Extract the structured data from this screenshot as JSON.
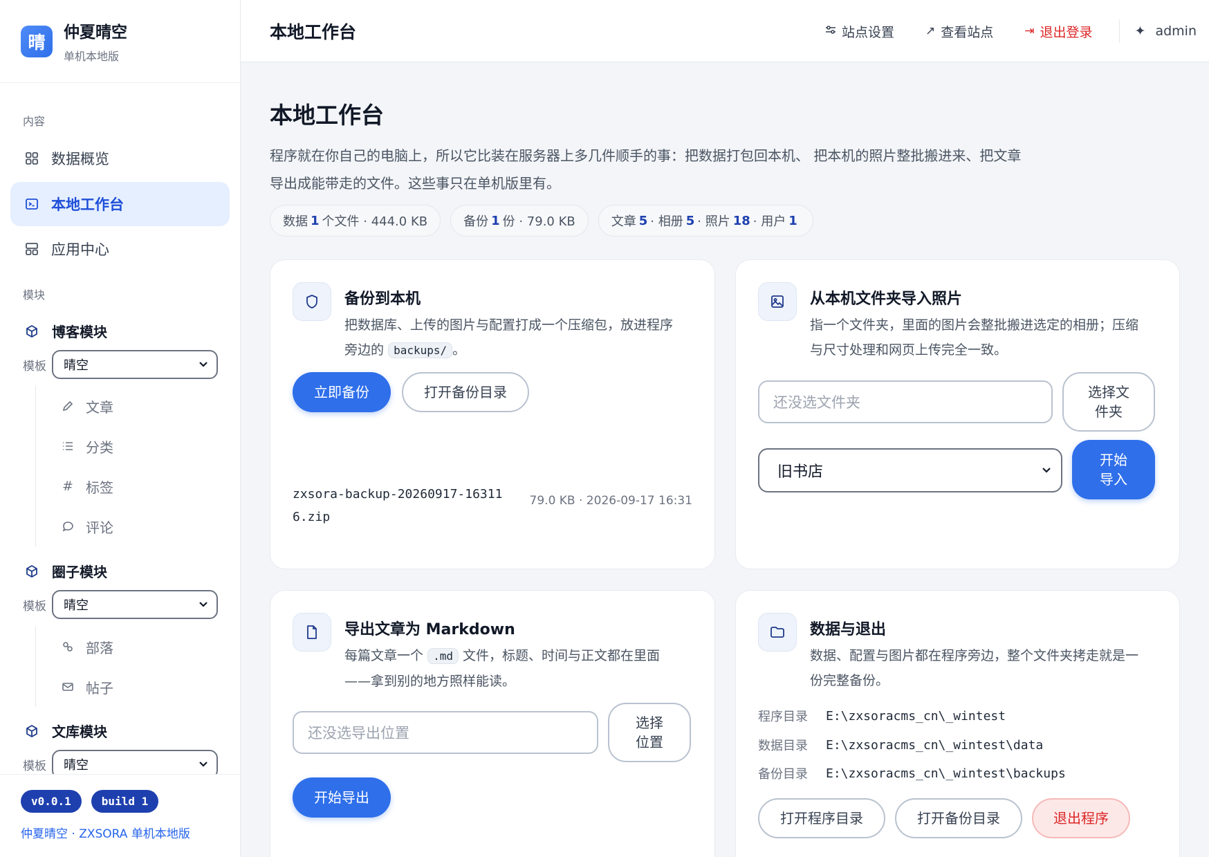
{
  "brand": {
    "logo_char": "晴",
    "title": "仲夏晴空",
    "subtitle": "单机本地版"
  },
  "sidebar": {
    "section_content": "内容",
    "nav": [
      {
        "label": "数据概览",
        "icon": "grid-icon"
      },
      {
        "label": "本地工作台",
        "icon": "terminal-icon",
        "active": true
      },
      {
        "label": "应用中心",
        "icon": "apps-icon"
      }
    ],
    "section_modules": "模块",
    "template_label": "模板",
    "modules": [
      {
        "title": "博客模块",
        "template": "晴空",
        "items": [
          {
            "label": "文章",
            "icon": "pencil-icon"
          },
          {
            "label": "分类",
            "icon": "list-icon"
          },
          {
            "label": "标签",
            "icon": "hash-icon"
          },
          {
            "label": "评论",
            "icon": "comment-icon"
          }
        ]
      },
      {
        "title": "圈子模块",
        "template": "晴空",
        "items": [
          {
            "label": "部落",
            "icon": "link-icon"
          },
          {
            "label": "帖子",
            "icon": "mail-icon"
          }
        ]
      },
      {
        "title": "文库模块",
        "template": "晴空",
        "items": []
      }
    ],
    "footer": {
      "version": "v0.0.1",
      "build": "build 1",
      "text": "仲夏晴空 · ZXSORA 单机本地版"
    }
  },
  "header": {
    "title": "本地工作台",
    "site_settings": "站点设置",
    "view_site": "查看站点",
    "logout": "退出登录",
    "user": "admin"
  },
  "page": {
    "title": "本地工作台",
    "desc_line1": "程序就在你自己的电脑上，所以它比装在服务器上多几件顺手的事：把数据打包回本机、 把本机的照片整批搬进来、把文章",
    "desc_line2": "导出成能带走的文件。这些事只在单机版里有。",
    "stats": {
      "data_prefix": "数据",
      "data_count": "1",
      "data_suffix": "个文件 · 444.0 KB",
      "backup_prefix": "备份",
      "backup_count": "1",
      "backup_suffix": "份 · 79.0 KB",
      "articles_label": "文章",
      "articles": "5",
      "albums_label": "· 相册",
      "albums": "5",
      "photos_label": "· 照片",
      "photos": "18",
      "users_label": "· 用户",
      "users": "1"
    }
  },
  "cards": {
    "backup": {
      "title": "备份到本机",
      "desc_before": "把数据库、上传的图片与配置打成一个压缩包，放进程序",
      "desc_mid": "旁边的",
      "desc_code": "backups/",
      "desc_after": "。",
      "btn_backup": "立即备份",
      "btn_open": "打开备份目录",
      "file_line1": "zxsora-backup-20260917-16311",
      "file_line2": "6.zip",
      "file_meta": "79.0 KB · 2026-09-17 16:31"
    },
    "import": {
      "title": "从本机文件夹导入照片",
      "desc_line1": "指一个文件夹，里面的图片会整批搬进选定的相册；压缩",
      "desc_line2": "与尺寸处理和网页上传完全一致。",
      "folder_placeholder": "还没选文件夹",
      "btn_choose_l1": "选择文",
      "btn_choose_l2": "件夹",
      "album": "旧书店",
      "btn_start_l1": "开始",
      "btn_start_l2": "导入"
    },
    "export": {
      "title": "导出文章为 Markdown",
      "desc_before": "每篇文章一个",
      "desc_code": ".md",
      "desc_after": "文件，标题、时间与正文都在里面",
      "desc_line2": "——拿到别的地方照样能读。",
      "location_placeholder": "还没选导出位置",
      "btn_choose_l1": "选择",
      "btn_choose_l2": "位置",
      "btn_export": "开始导出"
    },
    "data": {
      "title": "数据与退出",
      "desc_line1": "数据、配置与图片都在程序旁边，整个文件夹拷走就是一",
      "desc_line2": "份完整备份。",
      "dirs": [
        {
          "label": "程序目录",
          "value": "E:\\zxsoracms_cn\\_wintest"
        },
        {
          "label": "数据目录",
          "value": "E:\\zxsoracms_cn\\_wintest\\data"
        },
        {
          "label": "备份目录",
          "value": "E:\\zxsoracms_cn\\_wintest\\backups"
        }
      ],
      "btn_open_program": "打开程序目录",
      "btn_open_backup": "打开备份目录",
      "btn_exit": "退出程序"
    }
  },
  "colors": {
    "accent": "#2f6fea",
    "danger": "#dc2626",
    "badge": "#1e40af"
  }
}
